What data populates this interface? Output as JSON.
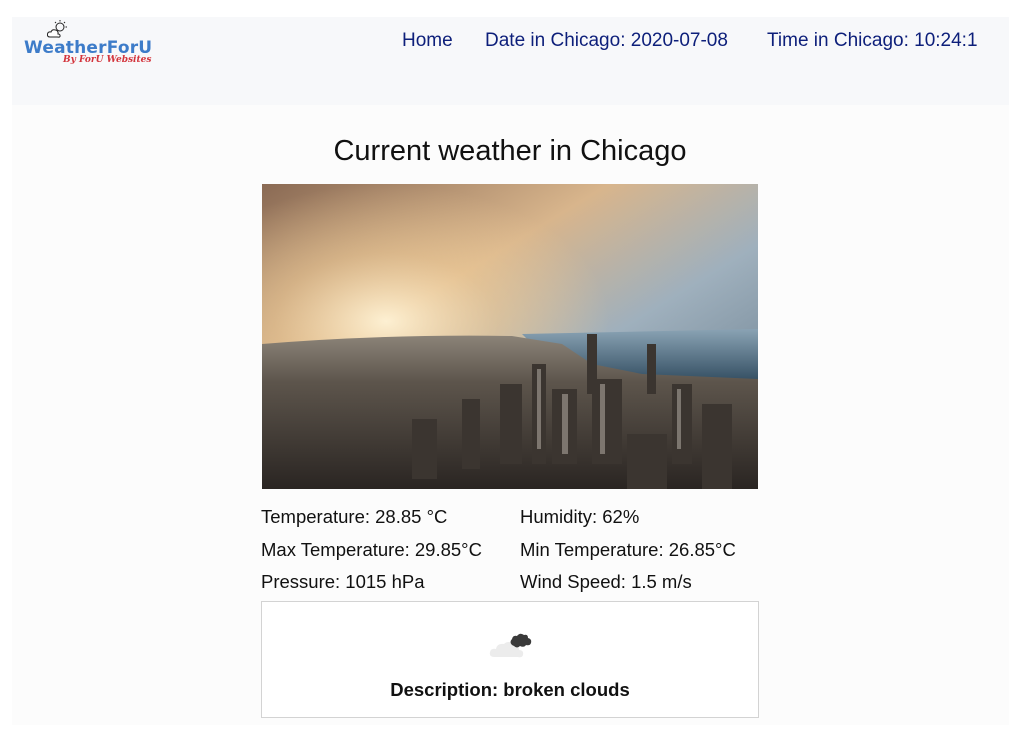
{
  "logo": {
    "name": "WeatherForU",
    "tagline": "By ForU Websites",
    "colors": {
      "word": "#3d7cc9",
      "tagline": "#d3343c"
    }
  },
  "nav": {
    "home": "Home",
    "date": "Date in Chicago: 2020-07-08",
    "time": "Time in Chicago: 10:24:1"
  },
  "main": {
    "title": "Current weather in Chicago",
    "image_subject": "chicago-skyline-sunset",
    "stats": {
      "temperature": "Temperature: 28.85 °C",
      "humidity": "Humidity: 62%",
      "max_temperature": "Max Temperature: 29.85°C",
      "min_temperature": "Min Temperature: 26.85°C",
      "pressure": "Pressure: 1015 hPa",
      "wind_speed": "Wind Speed: 1.5 m/s"
    },
    "description": {
      "icon": "broken-clouds-icon",
      "text": "Description: broken clouds"
    }
  },
  "colors": {
    "nav_link": "#0d1f7a",
    "navbar_bg": "#f7f8fa",
    "text": "#111111"
  }
}
